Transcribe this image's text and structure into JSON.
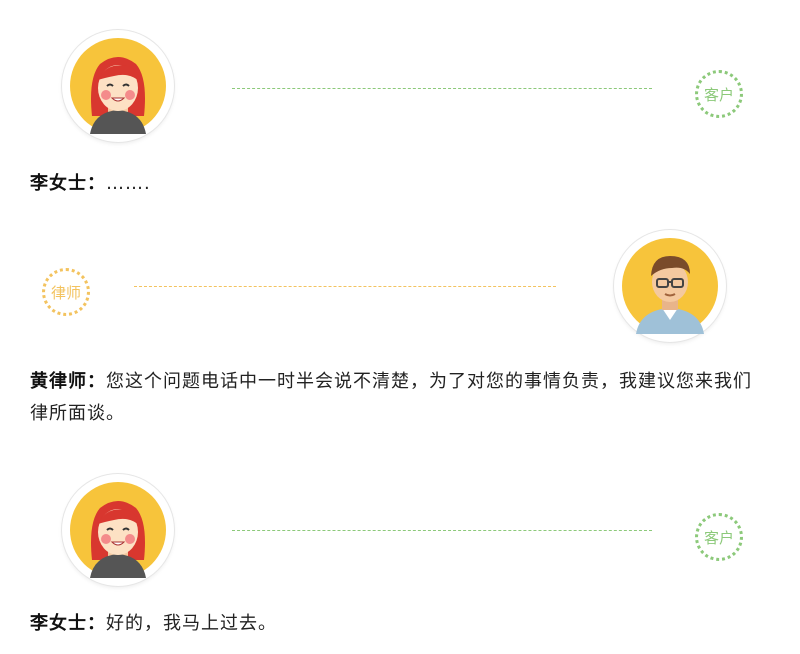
{
  "colors": {
    "client": "#8cc97a",
    "lawyer": "#f3c35f"
  },
  "blocks": [
    {
      "role_tag": "客户",
      "speaker": "李女士：",
      "text": "……."
    },
    {
      "role_tag": "律师",
      "speaker": "黄律师：",
      "text": "您这个问题电话中一时半会说不清楚，为了对您的事情负责，我建议您来我们律所面谈。"
    },
    {
      "role_tag": "客户",
      "speaker": "李女士：",
      "text": "好的，我马上过去。"
    }
  ]
}
